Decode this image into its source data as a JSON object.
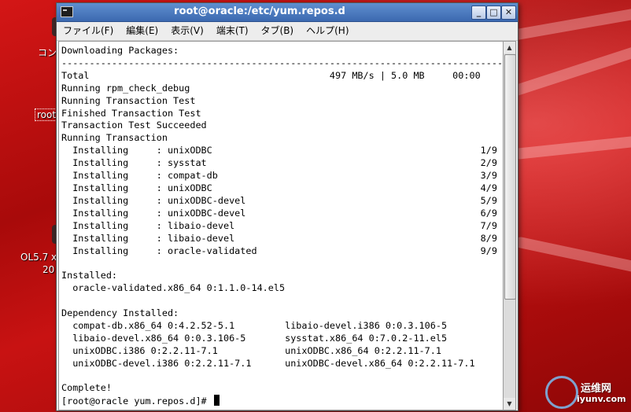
{
  "window": {
    "title": "root@oracle:/etc/yum.repos.d",
    "minimize": "_",
    "maximize": "□",
    "close": "✕"
  },
  "menu": [
    {
      "label": "ファイル(F)"
    },
    {
      "label": "編集(E)"
    },
    {
      "label": "表示(V)"
    },
    {
      "label": "端末(T)"
    },
    {
      "label": "タブ(B)"
    },
    {
      "label": "ヘルプ(H)"
    }
  ],
  "terminal": {
    "lines": [
      "Downloading Packages:",
      "--------------------------------------------------------------------------------",
      "Total                                           497 MB/s | 5.0 MB     00:00",
      "Running rpm_check_debug",
      "Running Transaction Test",
      "Finished Transaction Test",
      "Transaction Test Succeeded",
      "Running Transaction",
      "  Installing     : unixODBC                                                1/9",
      "  Installing     : sysstat                                                 2/9",
      "  Installing     : compat-db                                               3/9",
      "  Installing     : unixODBC                                                4/9",
      "  Installing     : unixODBC-devel                                          5/9",
      "  Installing     : unixODBC-devel                                          6/9",
      "  Installing     : libaio-devel                                            7/9",
      "  Installing     : libaio-devel                                            8/9",
      "  Installing     : oracle-validated                                        9/9",
      "",
      "Installed:",
      "  oracle-validated.x86_64 0:1.1.0-14.el5",
      "",
      "Dependency Installed:",
      "  compat-db.x86_64 0:4.2.52-5.1         libaio-devel.i386 0:0.3.106-5",
      "  libaio-devel.x86_64 0:0.3.106-5       sysstat.x86_64 0:7.0.2-11.el5",
      "  unixODBC.i386 0:2.2.11-7.1            unixODBC.x86_64 0:2.2.11-7.1",
      "  unixODBC-devel.i386 0:2.2.11-7.1      unixODBC-devel.x86_64 0:2.2.11-7.1",
      "",
      "Complete!"
    ],
    "prompt": "[root@oracle yum.repos.d]# "
  },
  "desktop": {
    "labels": [
      "コン",
      "root",
      "OL5.7 x",
      "20"
    ],
    "watermark": "运维网",
    "watermark_sub": "iyunv.com"
  }
}
